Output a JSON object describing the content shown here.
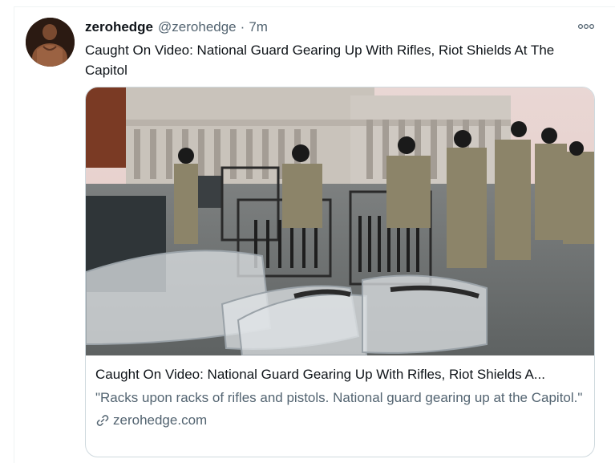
{
  "tweet": {
    "display_name": "zerohedge",
    "handle": "@zerohedge",
    "separator": "·",
    "time": "7m",
    "text": "Caught On Video: National Guard Gearing Up With Rifles, Riot Shields At The Capitol",
    "more_icon": "more-horizontal-icon"
  },
  "card": {
    "title": "Caught On Video: National Guard Gearing Up With Rifles, Riot Shields A...",
    "description": "\"Racks upon racks of rifles and pistols. National guard gearing up at the Capitol.\"",
    "domain": "zerohedge.com",
    "domain_icon": "link-icon"
  },
  "colors": {
    "text_primary": "#0f1419",
    "text_secondary": "#536471",
    "border": "#cfd9de"
  }
}
